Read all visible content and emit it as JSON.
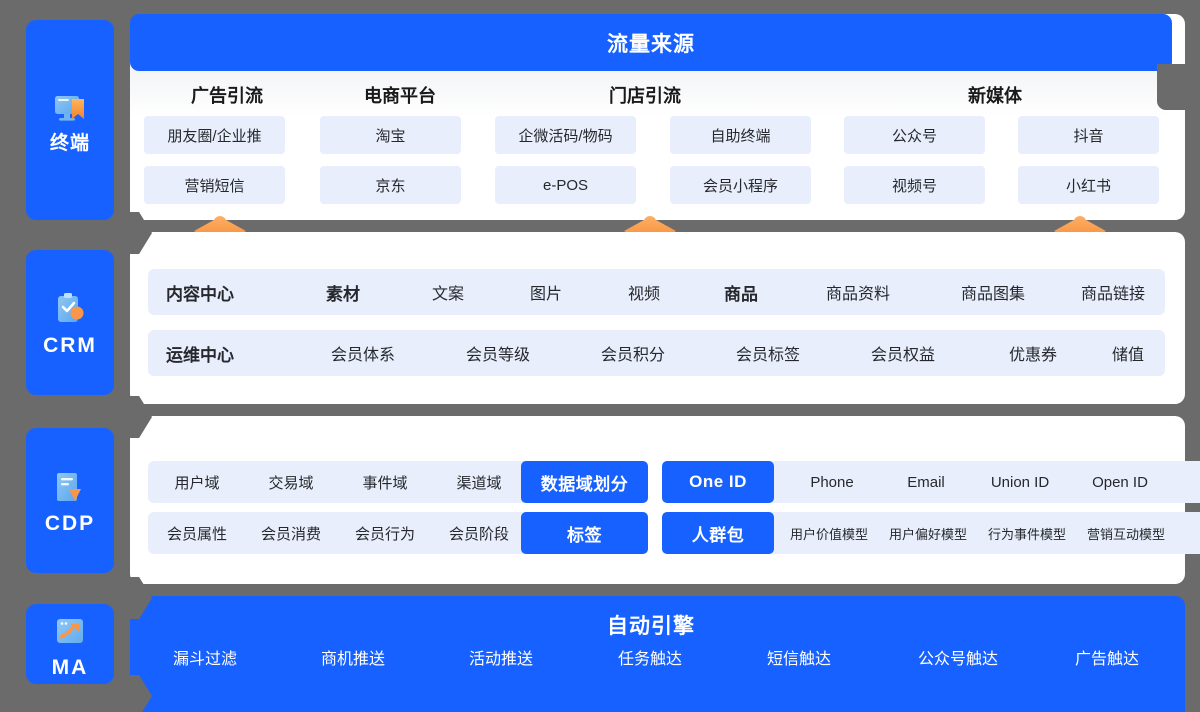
{
  "rail": {
    "items": [
      {
        "label": "终端",
        "icon": "monitor-bookmark-icon",
        "latin": false
      },
      {
        "label": "CRM",
        "icon": "clipboard-check-icon",
        "latin": true
      },
      {
        "label": "CDP",
        "icon": "document-fold-icon",
        "latin": true
      },
      {
        "label": "MA",
        "icon": "window-trend-arrow-icon",
        "latin": true
      }
    ]
  },
  "colors": {
    "brand_blue": "#1661ff",
    "chip_blue": "#e8eefb",
    "accent_orange": "#f7953f",
    "background_gray": "#6b6b6b",
    "panel_white": "#ffffff"
  },
  "traffic": {
    "title": "流量来源",
    "columns": [
      {
        "title": "广告引流",
        "items": [
          "朋友圈/企业推",
          "营销短信"
        ]
      },
      {
        "title": "电商平台",
        "items": [
          "淘宝",
          "京东"
        ]
      },
      {
        "title": "门店引流",
        "items": [
          "企微活码/物码",
          "e-POS",
          "自助终端",
          "会员小程序"
        ]
      },
      {
        "title": "新媒体",
        "items": [
          "公众号",
          "视频号",
          "抖音",
          "小红书"
        ]
      }
    ],
    "chips": [
      "朋友圈/企业推",
      "淘宝",
      "企微活码/物码",
      "自助终端",
      "公众号",
      "抖音",
      "营销短信",
      "京东",
      "e-POS",
      "会员小程序",
      "视频号",
      "小红书"
    ]
  },
  "crm": {
    "rows": [
      {
        "label": "内容中心",
        "group_a": "素材",
        "group_a_items": [
          "文案",
          "图片",
          "视频"
        ],
        "group_b": "商品",
        "group_b_items": [
          "商品资料",
          "商品图集",
          "商品链接"
        ]
      },
      {
        "label": "运维中心",
        "items": [
          "会员体系",
          "会员等级",
          "会员积分",
          "会员标签",
          "会员权益",
          "优惠券",
          "储值"
        ]
      }
    ],
    "cells_row1": [
      "内容中心",
      "素材",
      "文案",
      "图片",
      "视频",
      "商品",
      "商品资料",
      "商品图集",
      "商品链接"
    ],
    "cells_row2": [
      "运维中心",
      "会员体系",
      "会员等级",
      "会员积分",
      "会员标签",
      "会员权益",
      "优惠券",
      "储值"
    ]
  },
  "cdp": {
    "row1": {
      "domains": [
        "用户域",
        "交易域",
        "事件域",
        "渠道域"
      ],
      "domains_badge": "数据域划分",
      "id_badge": "One ID",
      "ids": [
        "Phone",
        "Email",
        "Union ID",
        "Open ID"
      ]
    },
    "row2": {
      "attributes": [
        "会员属性",
        "会员消费",
        "会员行为",
        "会员阶段"
      ],
      "attributes_badge": "标签",
      "audience_badge": "人群包",
      "models": [
        "用户价值模型",
        "用户偏好模型",
        "行为事件模型",
        "营销互动模型"
      ]
    }
  },
  "ma": {
    "title": "自动引擎",
    "items": [
      "漏斗过滤",
      "商机推送",
      "活动推送",
      "任务触达",
      "短信触达",
      "公众号触达",
      "广告触达"
    ]
  }
}
